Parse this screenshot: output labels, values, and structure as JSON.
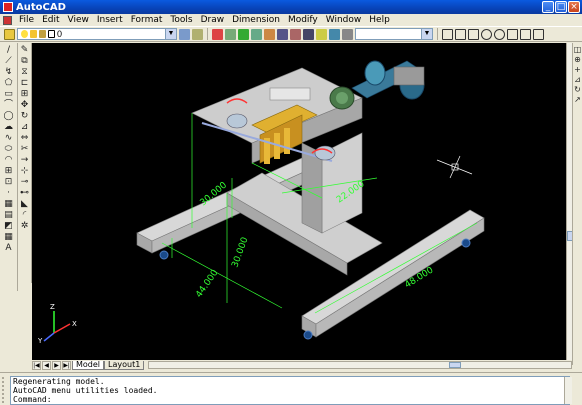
{
  "window": {
    "title": "AutoCAD"
  },
  "menu": [
    "File",
    "Edit",
    "View",
    "Insert",
    "Format",
    "Tools",
    "Draw",
    "Dimension",
    "Modify",
    "Window",
    "Help"
  ],
  "toolbar": {
    "layer_value": "0"
  },
  "left_tools": [
    "line",
    "construction-line",
    "polyline",
    "polygon",
    "rectangle",
    "arc",
    "circle",
    "revision-cloud",
    "spline",
    "ellipse",
    "ellipse-arc",
    "insert-block",
    "make-block",
    "point",
    "hatch",
    "gradient",
    "region",
    "table",
    "multiline-text"
  ],
  "left_tools_glyphs": [
    "/",
    "⟋",
    "↯",
    "⬠",
    "▭",
    "⌒",
    "◯",
    "☁",
    "∿",
    "⬭",
    "◠",
    "⊞",
    "⊡",
    "·",
    "▦",
    "▤",
    "◩",
    "▦",
    "A"
  ],
  "modify_tools": [
    "erase",
    "copy",
    "mirror",
    "offset",
    "array",
    "move",
    "rotate",
    "scale",
    "stretch",
    "trim",
    "extend",
    "break-at-point",
    "break",
    "join",
    "chamfer",
    "fillet",
    "explode"
  ],
  "modify_tools_glyphs": [
    "✎",
    "⧉",
    "⧖",
    "⊏",
    "⊞",
    "✥",
    "↻",
    "⊿",
    "⇔",
    "✂",
    "→",
    "⊹",
    "⊸",
    "⊷",
    "◣",
    "◜",
    "✲"
  ],
  "dimensions": [
    {
      "label": "30.000"
    },
    {
      "label": "22.000"
    },
    {
      "label": "30.000"
    },
    {
      "label": "44.000"
    },
    {
      "label": "48.000"
    }
  ],
  "ucs": {
    "x_label": "X",
    "y_label": "Y",
    "z_label": "Z"
  },
  "tabs": [
    "Model",
    "Layout1"
  ],
  "command_lines": [
    "Regenerating model.",
    "AutoCAD menu utilities loaded."
  ],
  "command_prompt": "Command:",
  "colors": {
    "background": "#000000",
    "dimension": "#33ff33",
    "frame": "#c8c8c8",
    "motor": "#2a6a8a",
    "gear": "#d8a020",
    "accent": "#ff3333"
  }
}
